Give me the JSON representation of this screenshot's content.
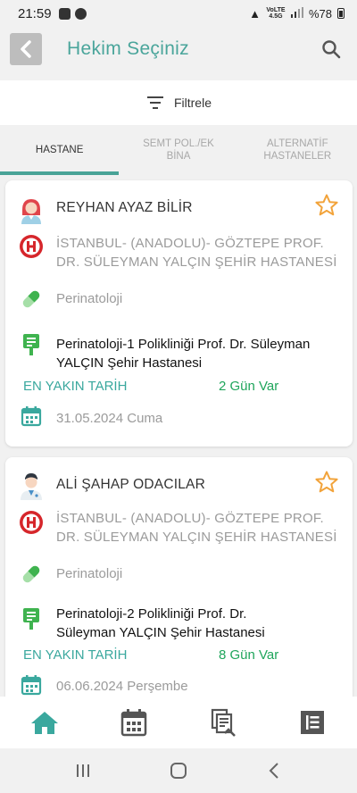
{
  "status_bar": {
    "time": "21:59",
    "network": "VoLTE 4.5G",
    "battery": "%78"
  },
  "header": {
    "title": "Hekim Seçiniz"
  },
  "filter": {
    "label": "Filtrele"
  },
  "tabs": [
    {
      "label": "HASTANE",
      "active": true
    },
    {
      "label": "SEMT POL./EK BİNA",
      "active": false
    },
    {
      "label": "ALTERNATİF HASTANELER",
      "active": false
    }
  ],
  "doctors": [
    {
      "name": "REYHAN AYAZ BİLİR",
      "gender_icon": "female-doctor-icon",
      "hospital": "İSTANBUL- (ANADOLU)- GÖZTEPE PROF. DR. SÜLEYMAN YALÇIN ŞEHİR HASTANESİ",
      "branch": "Perinatoloji",
      "clinic": "Perinatoloji-1 Polikliniği Prof. Dr. Süleyman YALÇIN Şehir Hastanesi",
      "nearest_label": "EN YAKIN TARİH",
      "days_left": "2 Gün Var",
      "date": "31.05.2024 Cuma"
    },
    {
      "name": "ALİ ŞAHAP ODACILAR",
      "gender_icon": "male-doctor-icon",
      "hospital": "İSTANBUL- (ANADOLU)- GÖZTEPE PROF. DR. SÜLEYMAN YALÇIN ŞEHİR HASTANESİ",
      "branch": "Perinatoloji",
      "clinic": "Perinatoloji-2 Polikliniği Prof. Dr. Süleyman YALÇIN Şehir Hastanesi",
      "nearest_label": "EN YAKIN TARİH",
      "days_left": "8 Gün Var",
      "date": "06.06.2024 Perşembe"
    }
  ],
  "bottom_nav": [
    "home-icon",
    "calendar-icon",
    "documents-icon",
    "menu-list-icon"
  ],
  "colors": {
    "accent": "#4aa59b",
    "days_green": "#1fa55b",
    "hospital_red": "#d6262b",
    "star_orange": "#f2a33a"
  }
}
